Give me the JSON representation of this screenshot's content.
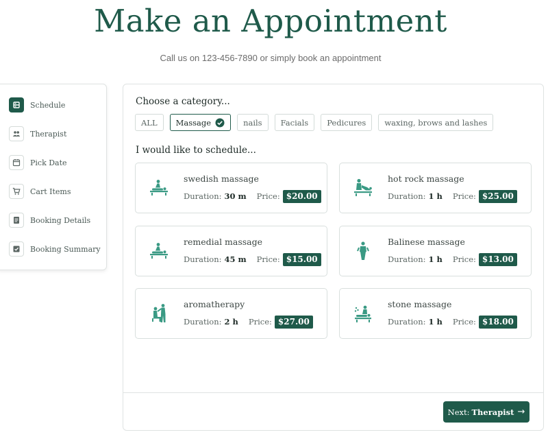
{
  "header": {
    "title": "Make an Appointment",
    "subtitle": "Call us on 123-456-7890 or simply book an appointment"
  },
  "sidebar": {
    "items": [
      {
        "label": "Schedule",
        "icon": "schedule-icon",
        "active": true
      },
      {
        "label": "Therapist",
        "icon": "people-icon",
        "active": false
      },
      {
        "label": "Pick Date",
        "icon": "calendar-icon",
        "active": false
      },
      {
        "label": "Cart Items",
        "icon": "cart-icon",
        "active": false
      },
      {
        "label": "Booking Details",
        "icon": "document-icon",
        "active": false
      },
      {
        "label": "Booking Summary",
        "icon": "checklist-icon",
        "active": false
      }
    ]
  },
  "main": {
    "category_title": "Choose a category...",
    "categories": [
      {
        "label": "ALL",
        "selected": false
      },
      {
        "label": "Massage",
        "selected": true
      },
      {
        "label": "nails",
        "selected": false
      },
      {
        "label": "Facials",
        "selected": false
      },
      {
        "label": "Pedicures",
        "selected": false
      },
      {
        "label": "waxing, brows and lashes",
        "selected": false
      }
    ],
    "schedule_title": "I would like to schedule...",
    "duration_label": "Duration:",
    "price_label": "Price:",
    "services": [
      {
        "name": "swedish massage",
        "duration": "30 m",
        "price": "$20.00",
        "icon": "massage-table-icon"
      },
      {
        "name": "hot rock massage",
        "duration": "1 h",
        "price": "$25.00",
        "icon": "massage-back-icon"
      },
      {
        "name": "remedial massage",
        "duration": "45 m",
        "price": "$15.00",
        "icon": "massage-table-icon"
      },
      {
        "name": "Balinese massage",
        "duration": "1 h",
        "price": "$13.00",
        "icon": "standing-person-icon"
      },
      {
        "name": "aromatherapy",
        "duration": "2 h",
        "price": "$27.00",
        "icon": "seated-therapy-icon"
      },
      {
        "name": "stone massage",
        "duration": "1 h",
        "price": "$18.00",
        "icon": "stone-massage-icon"
      }
    ],
    "next_button": {
      "prefix": "Next:",
      "target": "Therapist",
      "arrow": "→"
    }
  },
  "colors": {
    "brand": "#1f5a4a",
    "icon_teal": "#3a9a84",
    "border": "#dfe3e2",
    "muted_text": "#6b6b6b"
  }
}
